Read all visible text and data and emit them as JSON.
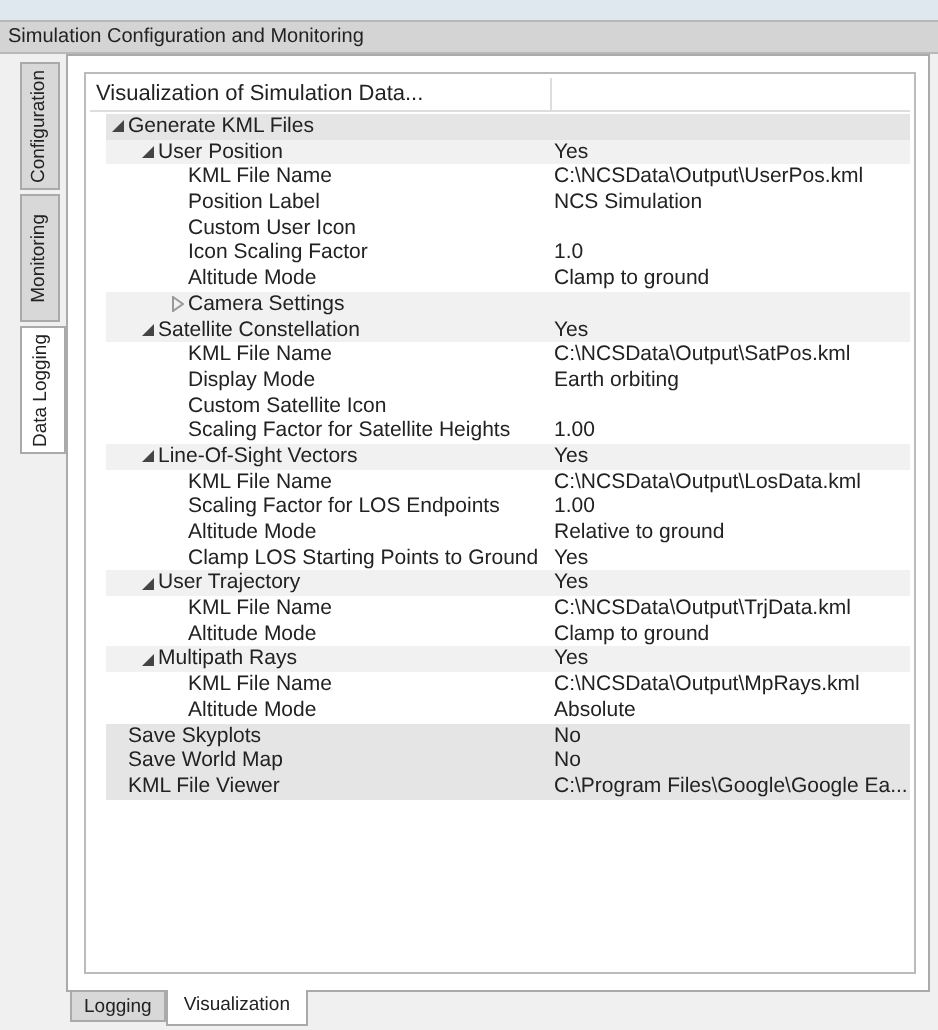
{
  "window": {
    "title": "Simulation Configuration and Monitoring"
  },
  "side_tabs": [
    {
      "label": "Configuration",
      "selected": false
    },
    {
      "label": "Monitoring",
      "selected": false
    },
    {
      "label": "Data Logging",
      "selected": true
    }
  ],
  "grid": {
    "header": "Visualization of Simulation Data...",
    "items": [
      {
        "name": "Generate KML Files",
        "expanded": true,
        "children": [
          {
            "name": "User Position",
            "value": "Yes",
            "expanded": true,
            "children": [
              {
                "name": "KML File Name",
                "value": "C:\\NCSData\\Output\\UserPos.kml"
              },
              {
                "name": "Position Label",
                "value": "NCS Simulation"
              },
              {
                "name": "Custom User Icon"
              },
              {
                "name": "Icon Scaling Factor",
                "value": "1.0"
              },
              {
                "name": "Altitude Mode",
                "value": "Clamp to ground"
              },
              {
                "name": "Camera Settings",
                "expanded": false
              }
            ]
          },
          {
            "name": "Satellite Constellation",
            "value": "Yes",
            "expanded": true,
            "children": [
              {
                "name": "KML File Name",
                "value": "C:\\NCSData\\Output\\SatPos.kml"
              },
              {
                "name": "Display Mode",
                "value": "Earth orbiting"
              },
              {
                "name": "Custom Satellite Icon"
              },
              {
                "name": "Scaling Factor for Satellite Heights",
                "value": "1.00"
              }
            ]
          },
          {
            "name": "Line-Of-Sight Vectors",
            "value": "Yes",
            "expanded": true,
            "children": [
              {
                "name": "KML File Name",
                "value": "C:\\NCSData\\Output\\LosData.kml"
              },
              {
                "name": "Scaling Factor for LOS Endpoints",
                "value": "1.00"
              },
              {
                "name": "Altitude Mode",
                "value": "Relative to ground"
              },
              {
                "name": "Clamp LOS Starting Points to Ground",
                "value": "Yes"
              }
            ]
          },
          {
            "name": "User Trajectory",
            "value": "Yes",
            "expanded": true,
            "children": [
              {
                "name": "KML File Name",
                "value": "C:\\NCSData\\Output\\TrjData.kml"
              },
              {
                "name": "Altitude Mode",
                "value": "Clamp to ground"
              }
            ]
          },
          {
            "name": "Multipath Rays",
            "value": "Yes",
            "expanded": true,
            "children": [
              {
                "name": "KML File Name",
                "value": "C:\\NCSData\\Output\\MpRays.kml"
              },
              {
                "name": "Altitude Mode",
                "value": "Absolute"
              }
            ]
          }
        ]
      },
      {
        "name": "Save Skyplots",
        "value": "No"
      },
      {
        "name": "Save World Map",
        "value": "No"
      },
      {
        "name": "KML File Viewer",
        "value": "C:\\Program Files\\Google\\Google Ea..."
      }
    ]
  },
  "bottom_tabs": [
    {
      "label": "Logging",
      "selected": false
    },
    {
      "label": "Visualization",
      "selected": true
    }
  ]
}
